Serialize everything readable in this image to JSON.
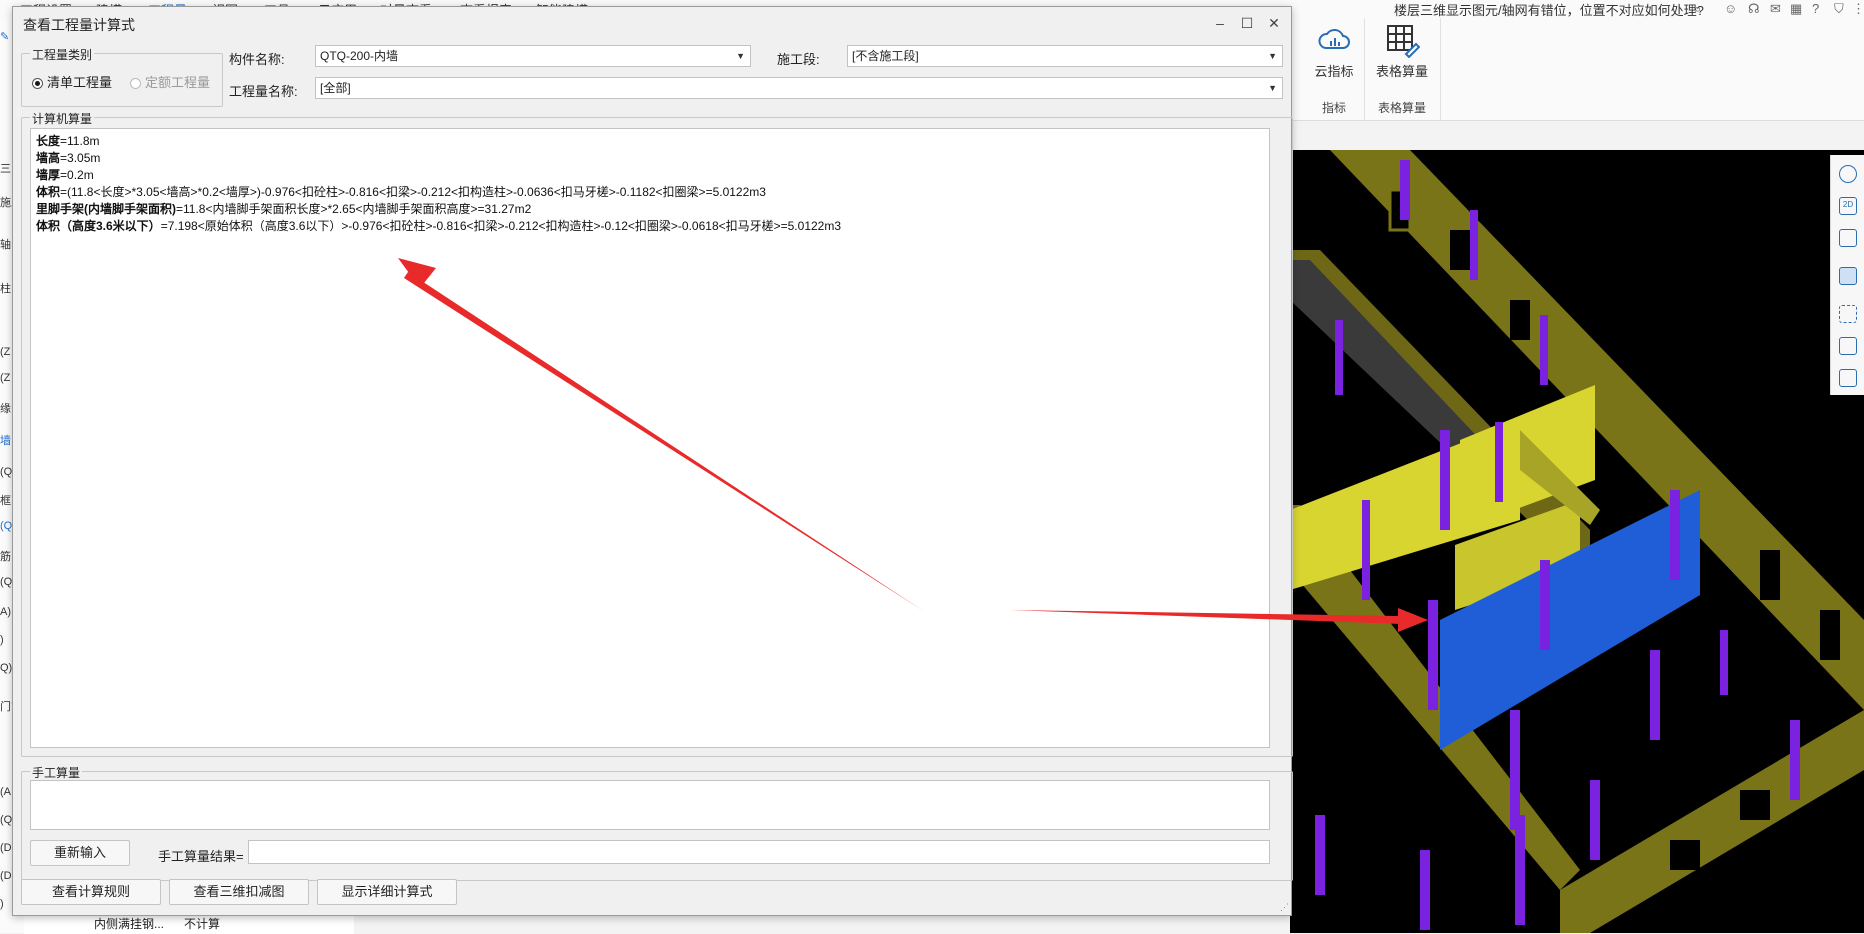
{
  "app": {
    "top_tabs": [
      "工程设置",
      "建模",
      "工程量",
      "视图",
      "工具",
      "云应用",
      "对量查看",
      "查看报表",
      "智能建模"
    ],
    "question_text": "楼层三维显示图元/轴网有错位，位置不对应如何处理?",
    "left_strip_texts": [
      "三",
      "施工",
      "轴",
      "柱",
      "(Z",
      "(Z",
      "缘",
      "墙",
      "(Q",
      "框",
      "(Q",
      "筋",
      "(Q",
      "A)",
      ")",
      "Q)",
      "门窗",
      "(A",
      "(Q",
      "(D",
      "(D",
      ")"
    ],
    "ribbon": {
      "cloud_index_label": "云指标",
      "cloud_index_group": "指标",
      "table_calc_label": "表格算量",
      "table_calc_group": "表格算量"
    },
    "bottom_table": {
      "name": "内侧满挂钢...",
      "value": "不计算"
    }
  },
  "dialog": {
    "title": "查看工程量计算式",
    "qty_type_legend": "工程量类别",
    "radio_bill": "清单工程量",
    "radio_quota": "定额工程量",
    "component_label": "构件名称:",
    "component_value": "QTQ-200-内墙",
    "segment_label": "施工段:",
    "segment_value": "[不含施工段]",
    "qty_name_label": "工程量名称:",
    "qty_name_value": "[全部]",
    "computer_calc_legend": "计算机算量",
    "calc_lines": [
      {
        "key": "长度",
        "text": "=11.8m"
      },
      {
        "key": "墙高",
        "text": "=3.05m"
      },
      {
        "key": "墙厚",
        "text": "=0.2m"
      },
      {
        "key": "体积",
        "text": "=(11.8<长度>*3.05<墙高>*0.2<墙厚>)-0.976<扣砼柱>-0.816<扣梁>-0.212<扣构造柱>-0.0636<扣马牙槎>-0.1182<扣圈梁>=5.0122m3"
      },
      {
        "key": "里脚手架(内墙脚手架面积)",
        "text": "=11.8<内墙脚手架面积长度>*2.65<内墙脚手架面积高度>=31.27m2"
      },
      {
        "key": "体积（高度3.6米以下）",
        "text": "=7.198<原始体积（高度3.6以下）>-0.976<扣砼柱>-0.816<扣梁>-0.212<扣构造柱>-0.12<扣圈梁>-0.0618<扣马牙槎>=5.0122m3"
      }
    ],
    "manual_calc_legend": "手工算量",
    "reenter_button": "重新输入",
    "manual_result_label": "手工算量结果=",
    "manual_result_value": "",
    "view_rules_button": "查看计算规则",
    "view_3d_button": "查看三维扣减图",
    "show_detail_button": "显示详细计算式"
  },
  "colors": {
    "arrow": "#e82a2a",
    "wall_yellow": "#d8d430",
    "wall_olive": "#7a7418",
    "wall_blue": "#1f5ed6",
    "column_purple": "#7b22e0"
  }
}
